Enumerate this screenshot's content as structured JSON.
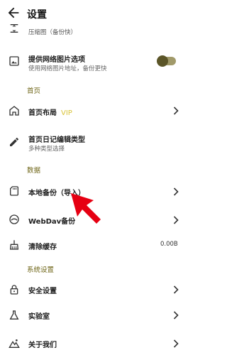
{
  "header": {
    "title": "设置"
  },
  "items": {
    "compress": {
      "subtitle": "压缩图（备份快）"
    },
    "network_image": {
      "title": "提供网络图片选项",
      "subtitle": "使用网络图片地址，备份更快"
    },
    "home_layout": {
      "title": "首页布局",
      "badge": "VIP"
    },
    "diary_edit_type": {
      "title": "首页日记编辑类型",
      "subtitle": "多种类型选择"
    },
    "local_backup": {
      "title": "本地备份（导入）"
    },
    "webdav_backup": {
      "title": "WebDav备份"
    },
    "clear_cache": {
      "title": "清除缓存",
      "value": "0.00B"
    },
    "security": {
      "title": "安全设置"
    },
    "lab": {
      "title": "实验室"
    },
    "about": {
      "title": "关于我们"
    }
  },
  "sections": {
    "home": "首页",
    "data": "数据",
    "system": "系统设置"
  },
  "toggle": {
    "network_image_enabled": false
  },
  "colors": {
    "section_text": "#6f6618",
    "vip": "#d9c43a",
    "arrow": "#e60012",
    "toggle_track": "#a19a6a"
  }
}
